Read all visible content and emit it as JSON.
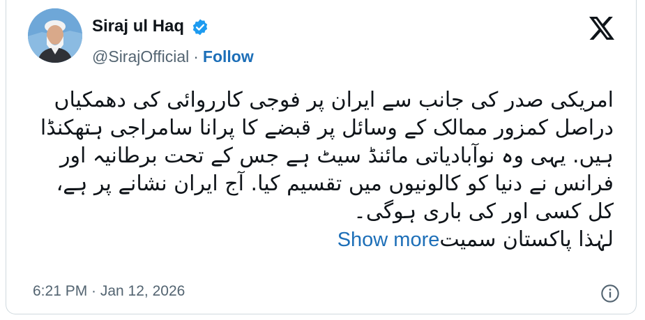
{
  "author": {
    "name": "Siraj ul Haq",
    "handle": "@SirajOfficial",
    "separator": "·",
    "follow_label": "Follow",
    "verified_icon": "verified-badge-icon"
  },
  "tweet": {
    "lines": [
      "امریکی صدر کی جانب سے ایران پر فوجی کارروائی کی دھمکیاں",
      "دراصل کمزور ممالک کے وسائل پر قبضے کا پرانا سامراجی ہتھکنڈا",
      "ہیں. یہی وہ نوآبادیاتی مائنڈ سیٹ ہے جس کے تحت برطانیہ اور",
      "فرانس نے دنیا کو کالونیوں میں تقسیم کیا. آج ایران نشانے پر ہے،",
      "کل کسی اور کی باری ہوگی۔"
    ],
    "last_line": "لہٰذا پاکستان سمیت",
    "show_more_label": "Show more"
  },
  "footer": {
    "timestamp": "6:21 PM · Jan 12, 2026",
    "info_icon": "info-icon"
  },
  "colors": {
    "link": "#1d6fb8",
    "text": "#0f1419",
    "muted": "#536471",
    "border": "#cfd9de",
    "verified": "#1d9bf0"
  }
}
